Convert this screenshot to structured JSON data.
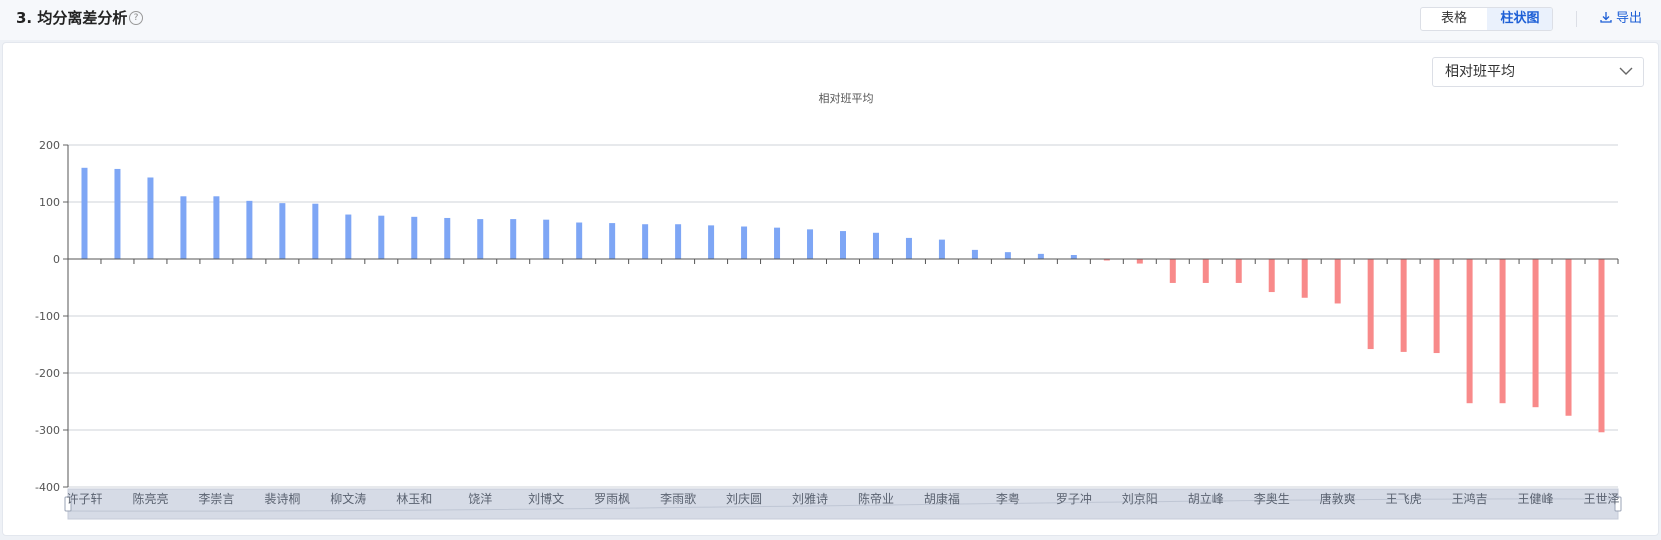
{
  "header": {
    "title": "3. 均分离差分析",
    "help_icon": "question-circle-icon",
    "view_table": "表格",
    "view_bar": "柱状图",
    "export_label": "导出",
    "export_icon": "download-icon"
  },
  "select": {
    "value": "相对班平均",
    "icon": "chevron-down-icon"
  },
  "colors": {
    "positive": "#7ea6f5",
    "negative": "#f88a8a",
    "accent": "#1d5fd6"
  },
  "chart_data": {
    "type": "bar",
    "title": "相对班平均",
    "xlabel": "",
    "ylabel": "",
    "ylim": [
      -400,
      200
    ],
    "yticks": [
      200,
      100,
      0,
      -100,
      -200,
      -300,
      -400
    ],
    "grid": true,
    "categories": [
      "许子轩",
      "",
      "陈亮亮",
      "",
      "李崇言",
      "",
      "裴诗桐",
      "",
      "柳文涛",
      "",
      "林玉和",
      "",
      "饶洋",
      "",
      "刘博文",
      "",
      "罗雨枫",
      "",
      "李雨歌",
      "",
      "刘庆圆",
      "",
      "刘雅诗",
      "",
      "陈帝业",
      "",
      "胡康福",
      "",
      "李粤",
      "",
      "罗子冲",
      "",
      "刘京阳",
      "",
      "胡立峰",
      "",
      "李奥生",
      "",
      "唐敦爽",
      "",
      "王飞虎",
      "",
      "王鸿吉",
      "",
      "王健峰",
      "",
      "王世泽"
    ],
    "values": [
      160,
      158,
      143,
      110,
      110,
      102,
      98,
      97,
      78,
      76,
      74,
      72,
      70,
      70,
      69,
      64,
      63,
      61,
      61,
      59,
      57,
      55,
      52,
      49,
      46,
      37,
      34,
      16,
      12,
      9,
      7,
      -2,
      -8,
      -42,
      -42,
      -42,
      -58,
      -68,
      -78,
      -158,
      -163,
      -165,
      -253,
      -253,
      -260,
      -275,
      -304
    ]
  }
}
